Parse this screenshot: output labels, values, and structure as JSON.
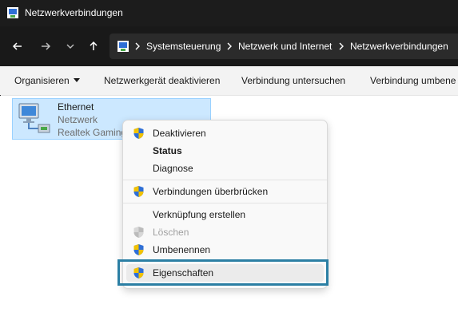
{
  "window": {
    "title": "Netzwerkverbindungen",
    "app_icon": "network-connections-icon"
  },
  "nav": {
    "back_icon": "arrow-left-icon",
    "forward_icon": "arrow-right-icon",
    "recent_icon": "chevron-down-icon",
    "up_icon": "arrow-up-icon",
    "breadcrumbs": [
      "Systemsteuerung",
      "Netzwerk und Internet",
      "Netzwerkverbindungen"
    ]
  },
  "commandbar": {
    "organize": "Organisieren",
    "disable_device": "Netzwerkgerät deaktivieren",
    "diagnose": "Verbindung untersuchen",
    "rename": "Verbindung umbene"
  },
  "connection": {
    "name": "Ethernet",
    "network": "Netzwerk",
    "adapter": "Realtek Gaming"
  },
  "context_menu": {
    "items": [
      {
        "label": "Deaktivieren",
        "shield": true
      },
      {
        "label": "Status",
        "bold": true
      },
      {
        "label": "Diagnose"
      },
      {
        "label": "Verbindungen überbrücken",
        "shield": true
      },
      {
        "label": "Verknüpfung erstellen"
      },
      {
        "label": "Löschen",
        "shield": true,
        "disabled": true
      },
      {
        "label": "Umbenennen",
        "shield": true
      },
      {
        "label": "Eigenschaften",
        "shield": true,
        "highlighted": true
      }
    ]
  },
  "colors": {
    "highlight_border": "#2b7fa4",
    "selection_bg": "#cce8ff",
    "shield_blue": "#2f6fd6",
    "shield_yellow": "#f2c200"
  }
}
